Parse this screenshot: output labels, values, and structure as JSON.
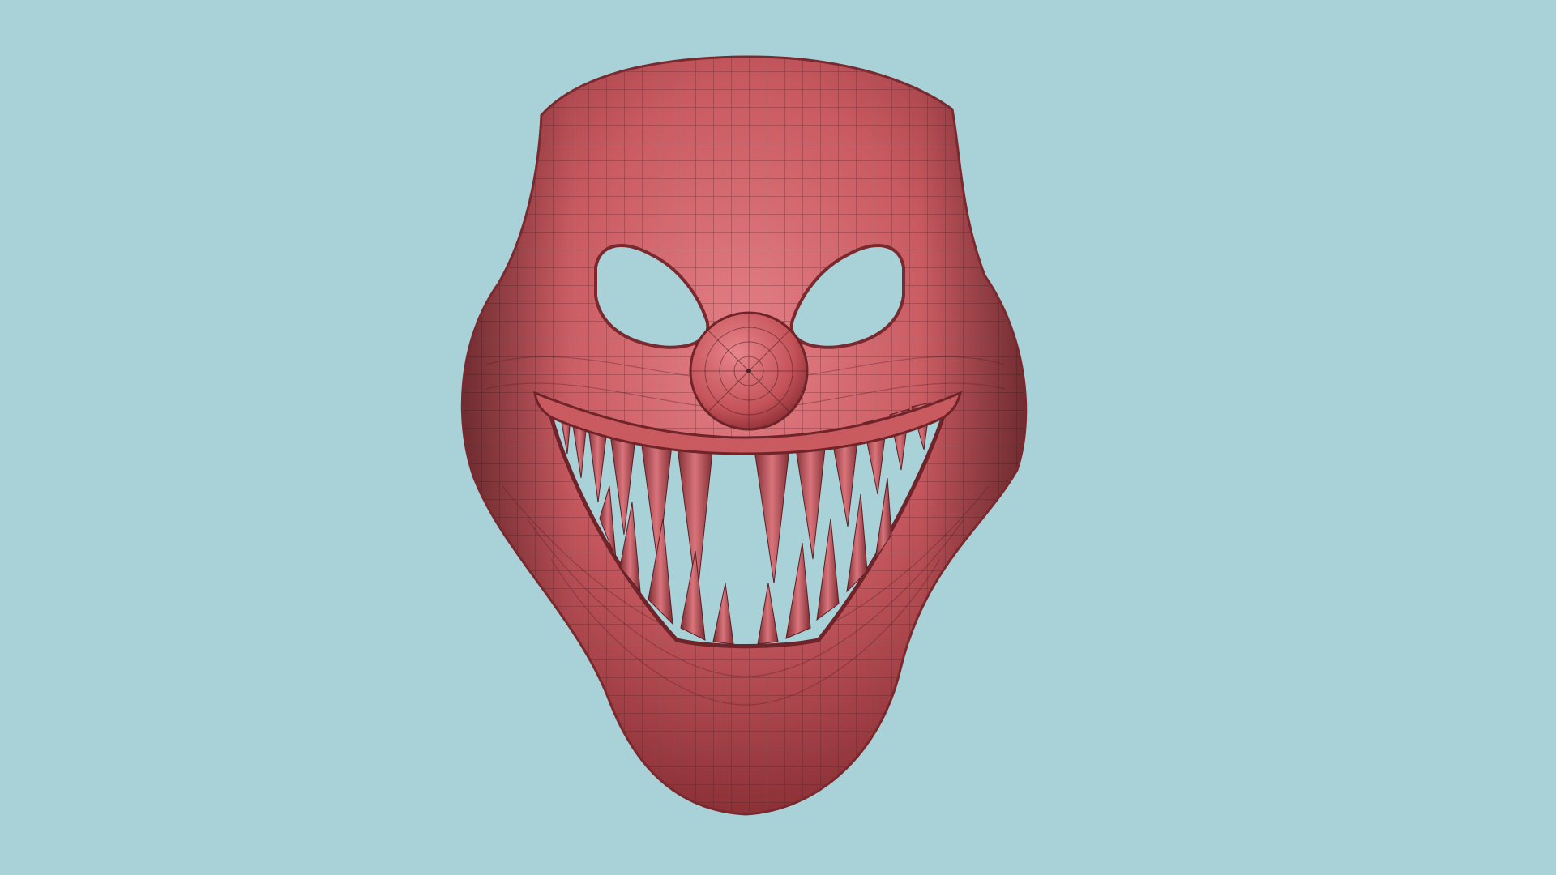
{
  "scene": {
    "subject": "",
    "colors": {
      "background": "#a8d1d8",
      "mask_base": "#c85a60",
      "mask_light": "#e07a80",
      "mask_dark": "#8f3338",
      "wire": "#4a1e22",
      "tooth_light": "#d77077",
      "tooth_dark": "#7d2b31"
    }
  }
}
